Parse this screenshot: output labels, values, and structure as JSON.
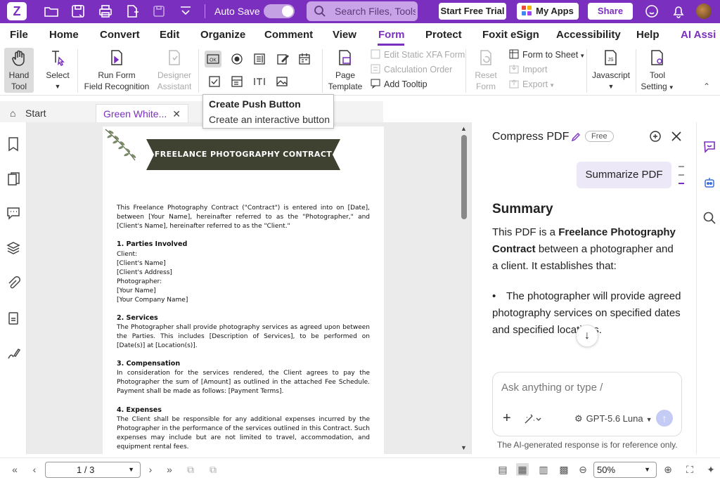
{
  "titlebar": {
    "auto_save_label": "Auto Save",
    "auto_save_on": true,
    "search_placeholder": "Search Files, Tools",
    "start_trial_label": "Start Free Trial",
    "my_apps_label": "My Apps",
    "share_label": "Share"
  },
  "menu": {
    "items": [
      "File",
      "Home",
      "Convert",
      "Edit",
      "Organize",
      "Comment",
      "View",
      "Form",
      "Protect",
      "Foxit eSign",
      "Accessibility",
      "Help",
      "AI Assi"
    ],
    "active": "Form"
  },
  "ribbon": {
    "hand_tool": "Hand\nTool",
    "hand_tool_l1": "Hand",
    "hand_tool_l2": "Tool",
    "select": "Select",
    "run_form_l1": "Run Form",
    "run_form_l2": "Field Recognition",
    "designer_l1": "Designer",
    "designer_l2": "Assistant",
    "page_template_l1": "Page",
    "page_template_l2": "Template",
    "edit_static_xfa": "Edit Static XFA Form",
    "calculation_order": "Calculation Order",
    "add_tooltip": "Add Tooltip",
    "reset_form_l1": "Reset",
    "reset_form_l2": "Form",
    "form_to_sheet": "Form to Sheet",
    "import": "Import",
    "export": "Export",
    "javascript": "Javascript",
    "tool_setting_l1": "Tool",
    "tool_setting_l2": "Setting"
  },
  "tooltip": {
    "title": "Create Push Button",
    "description": "Create an interactive button"
  },
  "tabs": {
    "start": "Start",
    "document": "Green White..."
  },
  "document": {
    "banner": "FREELANCE PHOTOGRAPHY CONTRACT",
    "intro": "This Freelance Photography Contract (\"Contract\") is entered into on [Date], between [Your Name], hereinafter referred to as the \"Photographer,\" and [Client's Name], hereinafter referred to as the \"Client.\"",
    "s1_title": "1. Parties Involved",
    "s1_lines": [
      "Client:",
      "[Client's Name]",
      "[Client's Address]",
      "Photographer:",
      "[Your Name]",
      "[Your Company Name]"
    ],
    "s2_title": "2. Services",
    "s2_body": "The Photographer shall provide photography services as agreed upon between the Parties. This includes [Description of Services], to be performed on [Date(s)] at [Location(s)].",
    "s3_title": "3. Compensation",
    "s3_body": "In consideration for the services rendered, the Client agrees to pay the Photographer the sum of [Amount] as outlined in the attached Fee Schedule. Payment shall be made as follows: [Payment Terms].",
    "s4_title": "4. Expenses",
    "s4_body": "The Client shall be responsible for any additional expenses incurred by the Photographer in the performance of the services outlined in this Contract. Such expenses may include but are not limited to travel, accommodation, and equipment rental fees."
  },
  "ai_panel": {
    "title": "Compress PDF",
    "badge": "Free",
    "summarize_button": "Summarize PDF",
    "summary_heading": "Summary",
    "summary_prefix": "This PDF is a ",
    "summary_bold": "Freelance Photography Contract",
    "summary_suffix": " between a photographer and a client. It establishes that:",
    "bullet_1": "The photographer will provide agreed photography services on specified dates and specified locations.",
    "ask_placeholder": "Ask anything or type /",
    "model": "GPT-5.6 Luna",
    "note": "The AI-generated response is for reference only."
  },
  "statusbar": {
    "page_indicator": "1 / 3",
    "zoom": "50%"
  },
  "colors": {
    "brand": "#7b2fbe",
    "banner": "#3f4230"
  }
}
